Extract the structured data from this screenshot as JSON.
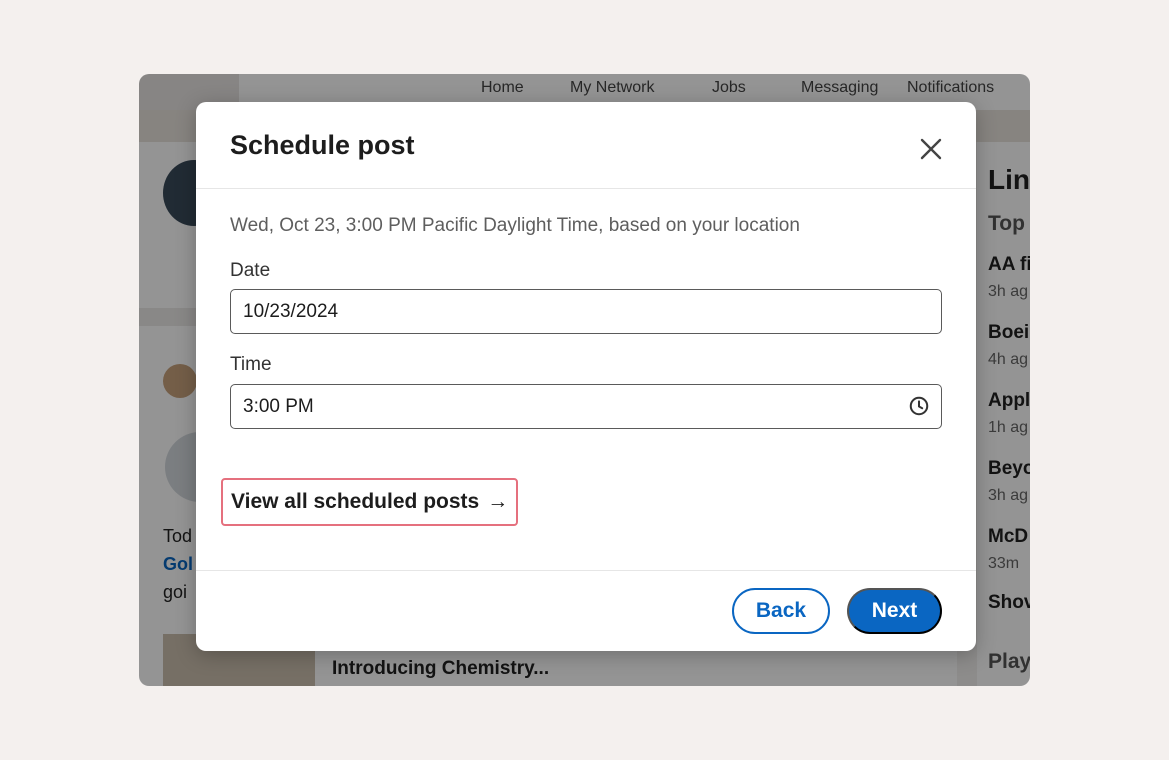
{
  "background_nav": {
    "items": [
      "Home",
      "My Network",
      "Jobs",
      "Messaging",
      "Notifications"
    ]
  },
  "background_feed": {
    "post_line1": "Tod",
    "post_line2_link": "Gol",
    "post_line3": "goi",
    "bottom_card_title": "Introducing Chemistry..."
  },
  "background_right": {
    "heading": "Linl",
    "subheading": "Top",
    "news": [
      {
        "title": "AA fi",
        "time": "3h ag"
      },
      {
        "title": "Boei",
        "time": "4h ag"
      },
      {
        "title": "Appl",
        "time": "1h ag"
      },
      {
        "title": "Beyo",
        "time": "3h ag"
      },
      {
        "title": "McD",
        "time": "33m"
      }
    ],
    "show_more": "Shov",
    "games_heading": "Play"
  },
  "modal": {
    "title": "Schedule post",
    "info": "Wed, Oct 23, 3:00 PM Pacific Daylight Time, based on your location",
    "date_label": "Date",
    "date_value": "10/23/2024",
    "time_label": "Time",
    "time_value": "3:00 PM",
    "view_all_label": "View all scheduled posts",
    "view_all_arrow": "→",
    "back_label": "Back",
    "next_label": "Next"
  },
  "colors": {
    "accent": "#0a66c2",
    "focus_outline": "#e5707e"
  }
}
